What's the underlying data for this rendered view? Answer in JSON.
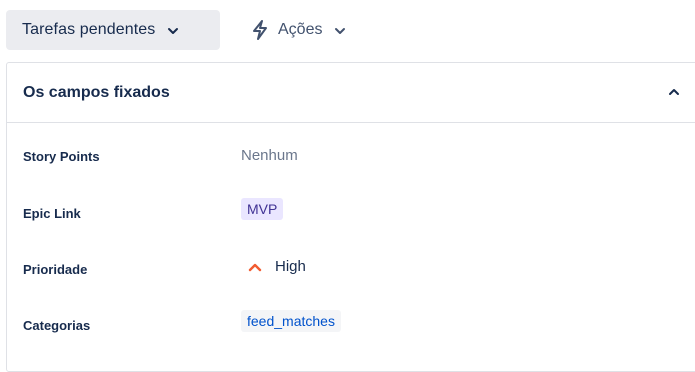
{
  "toolbar": {
    "status_label": "Tarefas pendentes",
    "actions_label": "Ações"
  },
  "panel": {
    "title": "Os campos fixados",
    "fields": [
      {
        "label": "Story Points",
        "value": "Nenhum"
      },
      {
        "label": "Epic Link",
        "value": "MVP"
      },
      {
        "label": "Prioridade",
        "value": "High"
      },
      {
        "label": "Categorias",
        "value": "feed_matches"
      }
    ]
  },
  "colors": {
    "button_bg": "#ebecf0",
    "priority_high": "#f15b30",
    "epic_bg": "#eae6ff",
    "epic_text": "#403294",
    "category_text": "#0052cc"
  },
  "icons": {
    "status_chevron": "chevron-down-icon",
    "actions": "lightning-bolt-icon",
    "actions_chevron": "chevron-down-icon",
    "collapse": "chevron-up-icon",
    "priority": "priority-high-icon"
  }
}
